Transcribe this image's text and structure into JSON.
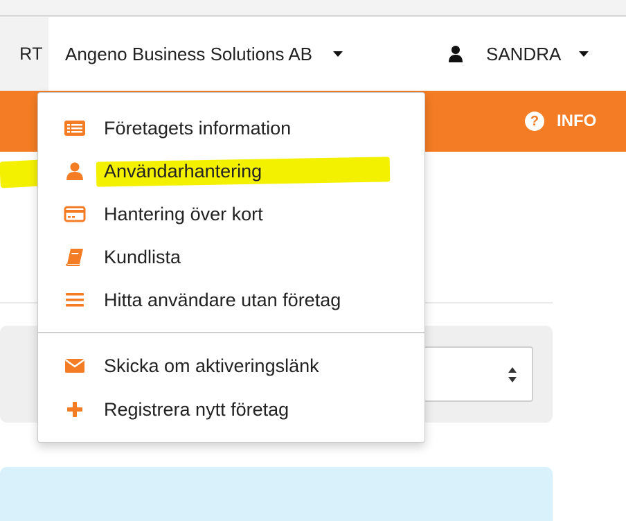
{
  "navbar": {
    "prev_item_label": "RT",
    "company_label": "Angeno Business Solutions AB",
    "user_label": "SANDRA"
  },
  "orange_bar": {
    "info_label": "INFO",
    "info_icon_glyph": "?"
  },
  "dropdown": {
    "items": [
      {
        "label": "Företagets information",
        "icon": "list-card-icon"
      },
      {
        "label": "Användarhantering",
        "icon": "user-icon"
      },
      {
        "label": "Hantering över kort",
        "icon": "credit-card-icon"
      },
      {
        "label": "Kundlista",
        "icon": "book-icon"
      },
      {
        "label": "Hitta användare utan företag",
        "icon": "bars-icon"
      },
      {
        "label": "Skicka om aktiveringslänk",
        "icon": "envelope-icon"
      },
      {
        "label": "Registrera nytt företag",
        "icon": "plus-icon"
      }
    ]
  },
  "colors": {
    "accent": "#f47c24",
    "highlight": "#f4f100",
    "info_panel": "#d8f1fb",
    "panel_gray": "#efefef"
  }
}
